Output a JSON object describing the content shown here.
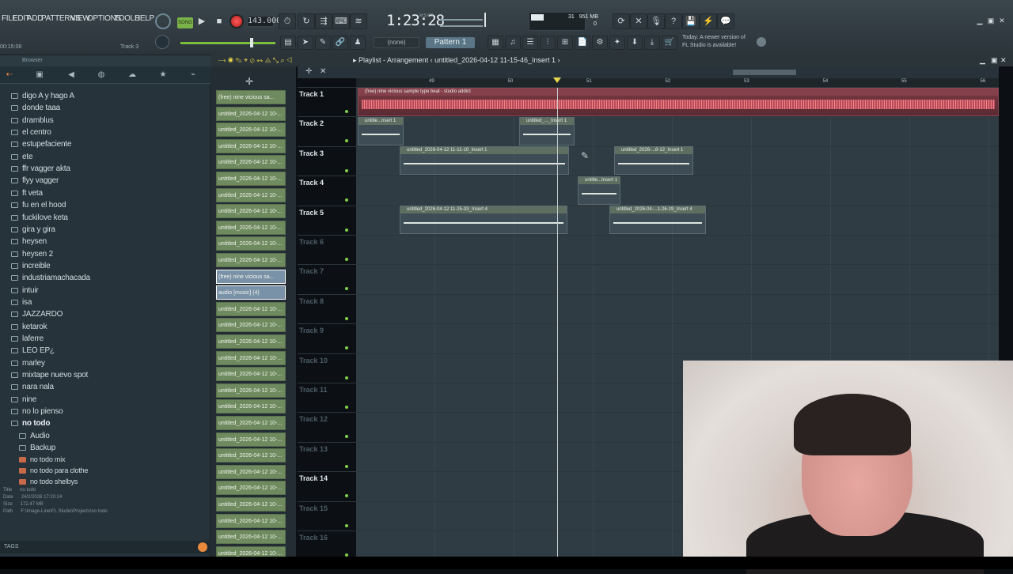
{
  "menubar": {
    "items": [
      "FILE",
      "EDIT",
      "ADD",
      "PATTERNS",
      "VIEW",
      "OPTIONS",
      "TOOLS",
      "HELP"
    ],
    "song_mode_label": "SONG",
    "tempo": "143.000",
    "time": "1:23:28",
    "time_unit": "M:S:CS",
    "hint_time": "00:15:08",
    "hint_track": "Track 3",
    "cpu": "31",
    "memory": "951 MB",
    "voices": "0",
    "snap": "(none)",
    "pattern": "Pattern 1",
    "notice": [
      "Today: A newer version of",
      "FL Studio is available!"
    ]
  },
  "browser": {
    "title": "Browser",
    "folders": [
      "digo A y hago A",
      "donde taaa",
      "dramblus",
      "el centro",
      "estupefaciente",
      "ete",
      "ffr vagger akta",
      "flyy vagger",
      "ft veta",
      "fu en el hood",
      "fuckilove keta",
      "gira y gira",
      "heysen",
      "heysen 2",
      "increible",
      "industriamachacada",
      "intuir",
      "isa",
      "JAZZARDO",
      "ketarok",
      "laferre",
      "LEO EP¿",
      "marley",
      "mixtape nuevo spot",
      "nara nala",
      "nine",
      "no lo pienso",
      "no todo"
    ],
    "subfolders": [
      "Audio",
      "Backup"
    ],
    "files": [
      "no todo mix",
      "no todo para clothe",
      "no todo shelbys"
    ],
    "info": {
      "title_label": "Title",
      "title_value": "no todo",
      "date_label": "Date",
      "date_value": "24/2/2026 17:20:24",
      "size_label": "Size",
      "size_value": "172.47 MB",
      "path_label": "Path",
      "path_value": "F:\\Image-Line\\FL Studio\\Projects\\no todo"
    },
    "tags_label": "TAGS"
  },
  "channels": [
    "(free) nine vicious sa...",
    "untitled_2026-04-12 10-...",
    "untitled_2026-04-12 10-...",
    "untitled_2026-04-12 10-...",
    "untitled_2026-04-12 10-...",
    "untitled_2026-04-12 10-...",
    "untitled_2026-04-12 10-...",
    "untitled_2026-04-12 10-...",
    "untitled_2026-04-12 10-...",
    "untitled_2026-04-12 10-...",
    "untitled_2026-04-12 10-...",
    "(free) nine vicious sa...",
    "audio [music] (4)",
    "untitled_2026-04-12 10-...",
    "untitled_2026-04-12 10-...",
    "untitled_2026-04-12 10-...",
    "untitled_2026-04-12 10-...",
    "untitled_2026-04-12 10-...",
    "untitled_2026-04-12 10-...",
    "untitled_2026-04-12 10-...",
    "untitled_2026-04-12 10-...",
    "untitled_2026-04-12 10-...",
    "untitled_2026-04-12 10-...",
    "untitled_2026-04-12 10-...",
    "untitled_2026-04-12 10-...",
    "untitled_2026-04-12 10-...",
    "untitled_2026-04-12 10-...",
    "untitled_2026-04-12 10-...",
    "untitled_2026-04-12 10-..."
  ],
  "playlist": {
    "title": "Playlist - Arrangement",
    "file": "untitled_2026-04-12 11-15-46_Insert 1",
    "bars": [
      "49",
      "50",
      "51",
      "52",
      "53",
      "54",
      "55",
      "56"
    ],
    "tracks": [
      "Track 1",
      "Track 2",
      "Track 3",
      "Track 4",
      "Track 5",
      "Track 6",
      "Track 7",
      "Track 8",
      "Track 9",
      "Track 10",
      "Track 11",
      "Track 12",
      "Track 13",
      "Track 14",
      "Track 15",
      "Track 16"
    ],
    "clips": [
      "(free) nine vicious sample type beat - studio addict",
      "untitle...nsert 1",
      "untitled_..._Insert 1",
      "untitled_2026-04-12 11-11-10_Insert 1",
      "untitled_2026-...8-12_Insert 1",
      "untitle...Insert 1",
      "untitled_2026-04-12 11-25-33_Insert 4",
      "untitled_2026-04-...1-26-19_Insert 4"
    ]
  }
}
